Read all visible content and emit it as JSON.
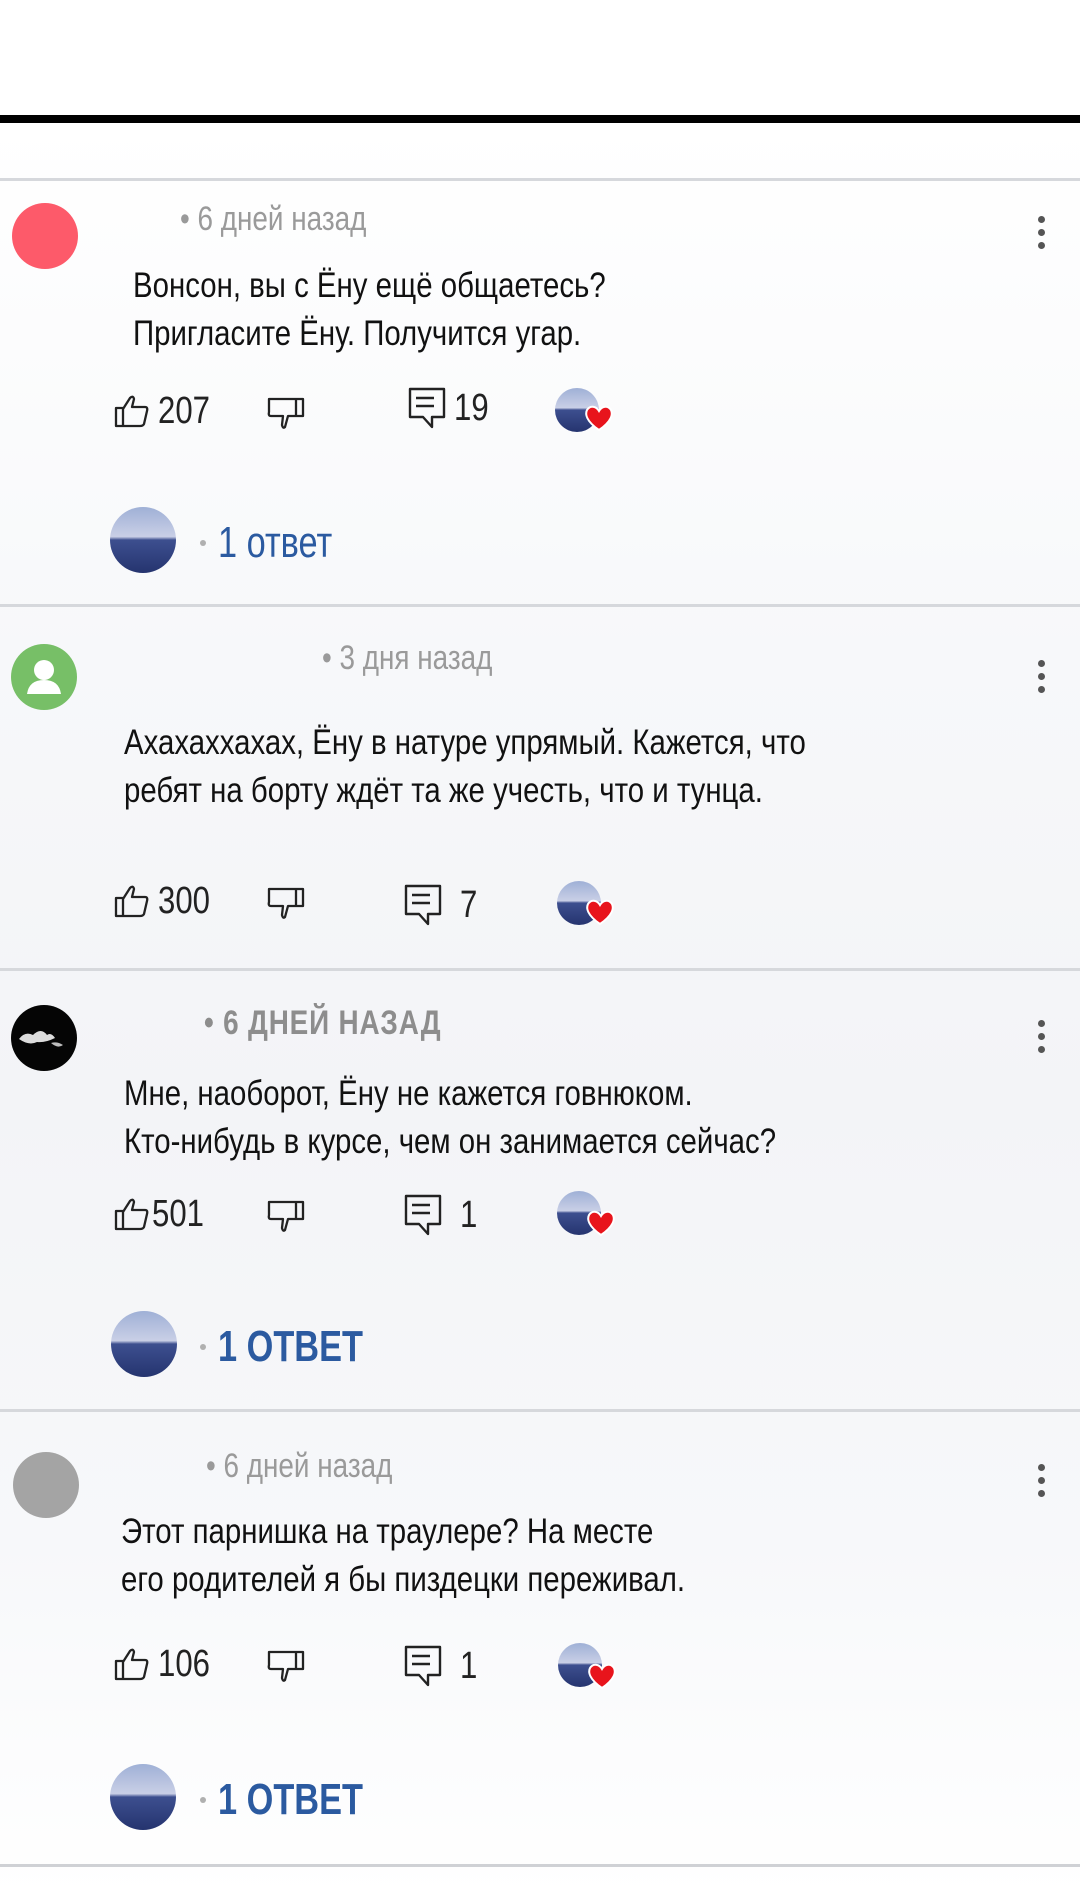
{
  "comments": [
    {
      "time": "6 дней назад",
      "line1": "Вонсон, вы с Ёну ещё общаетесь?",
      "line2": "Пригласите Ёну. Получится угар.",
      "likes": "207",
      "replies_count": "19",
      "reply_link": "1 ответ"
    },
    {
      "time": "3 дня назад",
      "line1": "Ахахаххахах, Ёну в натуре упрямый. Кажется, что",
      "line2": "ребят на борту ждёт та же учесть, что и тунца.",
      "likes": "300",
      "replies_count": "7",
      "reply_link": ""
    },
    {
      "time": "6 ДНЕЙ НАЗАД",
      "line1": "Мне, наоборот, Ёну не кажется говнюком.",
      "line2": "Кто-нибудь в курсе, чем он занимается сейчас?",
      "likes": "501",
      "replies_count": "1",
      "reply_link": "1 ОТВЕТ"
    },
    {
      "time": "6 дней назад",
      "line1": "Этот парнишка на траулере? На месте",
      "line2": "его родителей я бы пиздецки переживал.",
      "likes": "106",
      "replies_count": "1",
      "reply_link": "1 ОТВЕТ"
    }
  ],
  "icons": {
    "like": "thumbs-up-icon",
    "dislike": "thumbs-down-icon",
    "reply": "comment-icon",
    "menu": "more-vertical-icon",
    "author_heart": "heart-icon"
  },
  "colors": {
    "link": "#2b5aa0",
    "meta": "#9a9a9a",
    "heart": "#e8141c"
  }
}
